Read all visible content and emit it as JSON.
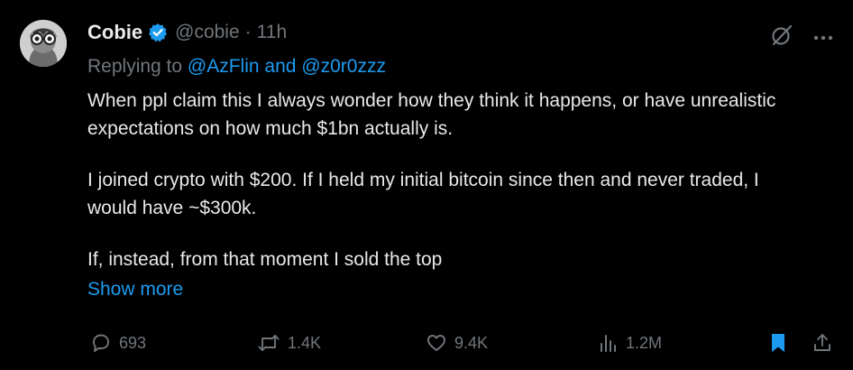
{
  "user": {
    "display_name": "Cobie",
    "handle": "@cobie",
    "separator": "·",
    "time": "11h",
    "verified_color": "#1d9bf0"
  },
  "reply": {
    "prefix": "Replying to",
    "mention_1": "@AzFlin",
    "joiner": "and",
    "mention_2": "@z0r0zzz"
  },
  "body": {
    "p1": "When ppl claim this I always wonder how they think it happens, or have unrealistic expectations on how much $1bn actually is.",
    "p2": "I joined crypto with $200. If I held my initial bitcoin since then and never traded, I would have ~$300k.",
    "p3": "If, instead, from that moment I sold the top",
    "show_more": "Show more"
  },
  "top_icons": [
    "grok-icon",
    "more-icon"
  ],
  "actions": {
    "replies": "693",
    "reposts": "1.4K",
    "likes": "9.4K",
    "views": "1.2M"
  },
  "colors": {
    "background": "#000000",
    "text": "#e7e9ea",
    "muted": "#71767b",
    "accent": "#1d9bf0"
  }
}
